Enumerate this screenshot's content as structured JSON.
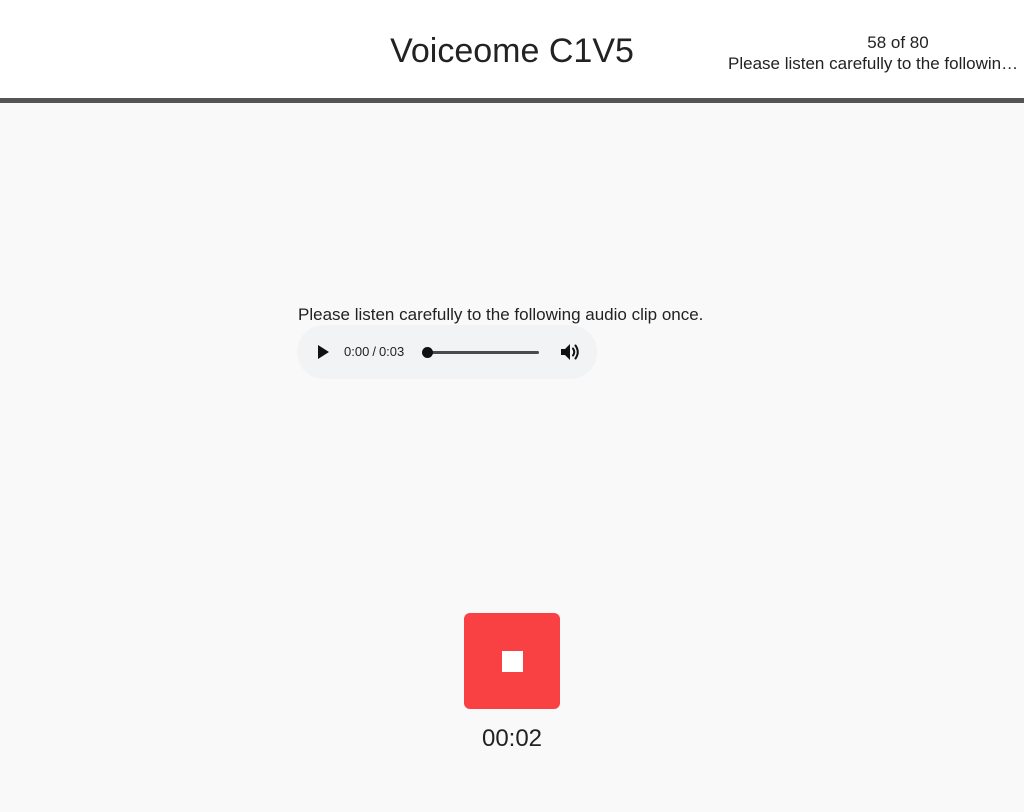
{
  "header": {
    "title": "Voiceome C1V5",
    "progress_counter": "58 of 80",
    "progress_task": "Please listen carefully to the following audio clip once."
  },
  "main": {
    "instruction": "Please listen carefully to the following audio clip once.",
    "audio_player": {
      "current_time": "0:00",
      "separator": "/",
      "duration": "0:03",
      "progress": 0,
      "play_icon": "play-icon",
      "volume_icon": "volume-icon"
    },
    "record": {
      "icon": "stop-icon",
      "color": "#f94144",
      "timer": "00:02"
    }
  },
  "colors": {
    "header_bg": "#ffffff",
    "header_border": "#555555",
    "page_bg": "#f9f9f9",
    "player_bg": "#f1f3f4",
    "record_red": "#f94144"
  }
}
